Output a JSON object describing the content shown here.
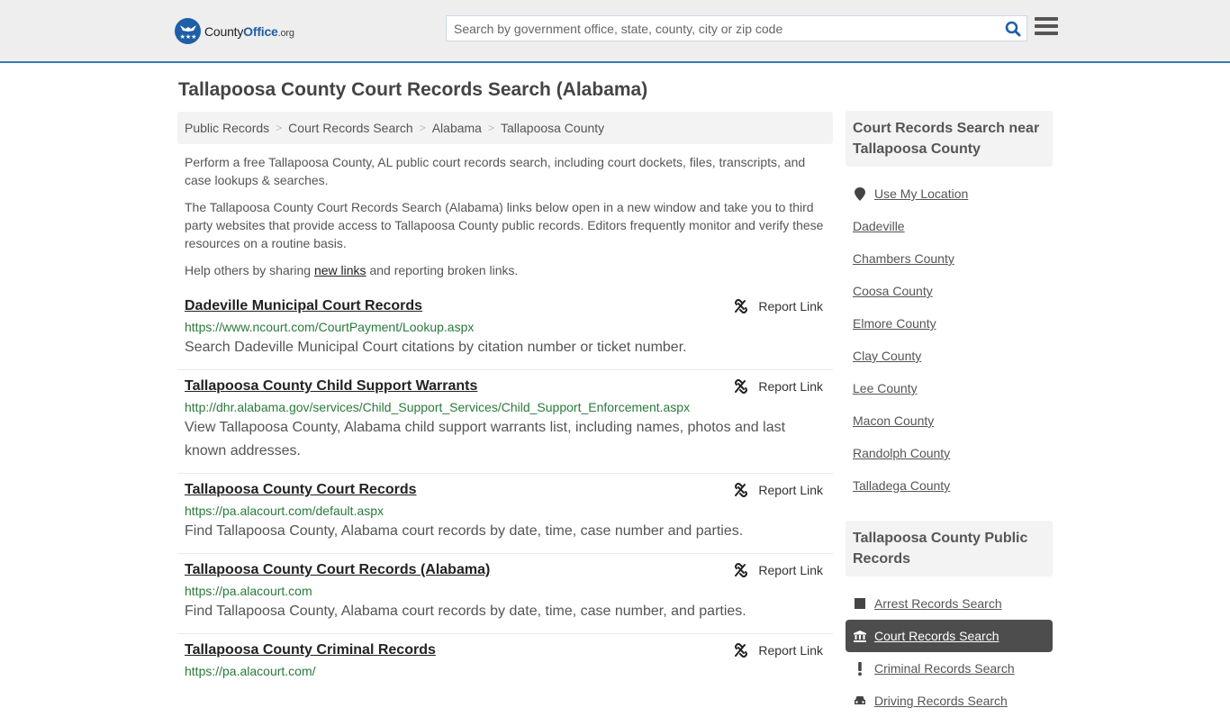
{
  "header": {
    "logo": {
      "part1": "County",
      "part2": "Office",
      "part3": ".org"
    },
    "search": {
      "placeholder": "Search by government office, state, county, city or zip code",
      "value": ""
    },
    "search_icon": "search-icon",
    "menu_icon": "hamburger-menu-icon"
  },
  "page": {
    "title": "Tallapoosa County Court Records Search (Alabama)",
    "breadcrumb": [
      "Public Records",
      "Court Records Search",
      "Alabama",
      "Tallapoosa County"
    ],
    "intro": {
      "p1": "Perform a free Tallapoosa County, AL public court records search, including court dockets, files, transcripts, and case lookups & searches.",
      "p2": "The Tallapoosa County Court Records Search (Alabama) links below open in a new window and take you to third party websites that provide access to Tallapoosa County public records. Editors frequently monitor and verify these resources on a routine basis.",
      "p3_before": "Help others by sharing ",
      "p3_link": "new links",
      "p3_after": " and reporting broken links."
    }
  },
  "results": [
    {
      "title": "Dadeville Municipal Court Records",
      "url": "https://www.ncourt.com/CourtPayment/Lookup.aspx",
      "desc": "Search Dadeville Municipal Court citations by citation number or ticket number.",
      "report": "Report Link"
    },
    {
      "title": "Tallapoosa County Child Support Warrants",
      "url": "http://dhr.alabama.gov/services/Child_Support_Services/Child_Support_Enforcement.aspx",
      "desc": "View Tallapoosa County, Alabama child support warrants list, including names, photos and last known addresses.",
      "report": "Report Link"
    },
    {
      "title": "Tallapoosa County Court Records",
      "url": "https://pa.alacourt.com/default.aspx",
      "desc": "Find Tallapoosa County, Alabama court records by date, time, case number and parties.",
      "report": "Report Link"
    },
    {
      "title": "Tallapoosa County Court Records (Alabama)",
      "url": "https://pa.alacourt.com",
      "desc": "Find Tallapoosa County, Alabama court records by date, time, case number, and parties.",
      "report": "Report Link"
    },
    {
      "title": "Tallapoosa County Criminal Records",
      "url": "https://pa.alacourt.com/",
      "desc": "",
      "report": "Report Link"
    }
  ],
  "sidebar": {
    "nearby": {
      "heading": "Court Records Search near Tallapoosa County",
      "use_location": "Use My Location",
      "items": [
        "Dadeville",
        "Chambers County",
        "Coosa County",
        "Elmore County",
        "Clay County",
        "Lee County",
        "Macon County",
        "Randolph County",
        "Talladega County"
      ]
    },
    "public_records": {
      "heading": "Tallapoosa County Public Records",
      "items": [
        {
          "label": "Arrest Records Search",
          "icon": "square-icon",
          "active": false
        },
        {
          "label": "Court Records Search",
          "icon": "courthouse-icon",
          "active": true
        },
        {
          "label": "Criminal Records Search",
          "icon": "exclamation-icon",
          "active": false
        },
        {
          "label": "Driving Records Search",
          "icon": "car-icon",
          "active": false
        }
      ]
    }
  },
  "colors": {
    "brand_blue": "#1f5fa7",
    "header_border": "#3a7aa8",
    "url_green": "#2a7a3a",
    "active_bg": "#4d4d4d"
  }
}
